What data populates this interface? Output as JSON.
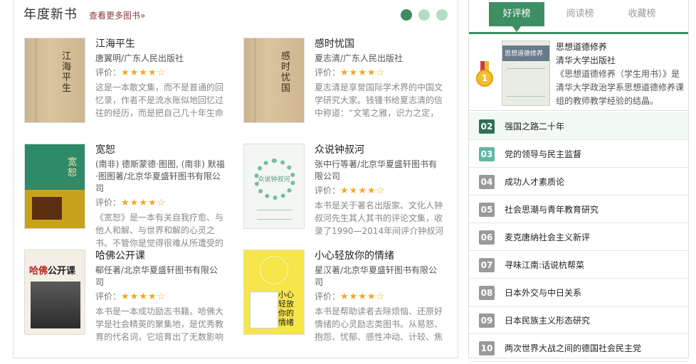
{
  "section": {
    "title": "年度新书",
    "more_link": "查看更多图书»"
  },
  "carousel": {
    "pages": 3,
    "active": 1
  },
  "books": [
    {
      "title": "江海平生",
      "author": "唐翼明/广东人民出版社",
      "rating_label": "评价：",
      "stars": "★★★★☆",
      "rating": 4,
      "desc": "这是一本散文集，而不是普通的回忆录，作者不是流水账似地回忆过往的经历，而是把自己几十年生命",
      "cover_text": "江海平生"
    },
    {
      "title": "感时忧国",
      "author": "夏志清/广东人民出版社",
      "rating_label": "评价：",
      "stars": "★★★★☆",
      "rating": 4,
      "desc": "夏志清是享誉国际学术界的中国文学研究大家。钱锺书给夏志清的信中称道：“文笔之雅，识力之定，",
      "cover_text": "感时忧国"
    },
    {
      "title": "宽恕",
      "author": "(南非) 德斯蒙德·图图, (南非) 默福·图图著/北京华夏盛轩图书有限公司",
      "rating_label": "评价：",
      "stars": "★★★★☆",
      "rating": 4,
      "desc": "《宽恕》是一本有关自我疗愈、与他人和解、与世界和解的心灵之书。不管你是觉得很难从所遭受的",
      "cover_text": "宽恕"
    },
    {
      "title": "众说钟叔河",
      "author": "张中行等著/北京华夏盛轩图书有限公司",
      "rating_label": "评价：",
      "stars": "★★★★☆",
      "rating": 4,
      "desc": "本书是关于著名出版家、文化人钟叔河先生其人其书的评论文集，收录了1990—2014年间评介钟叔河",
      "cover_text": "众说钟叔河"
    },
    {
      "title": "哈佛公开课",
      "author": "郗任著/北京华夏盛轩图书有限公司",
      "rating_label": "评价：",
      "stars": "★★★★☆",
      "rating": 4,
      "desc": "本书是一本成功励志书籍。哈佛大学是社会精英的聚集地，是优秀教育的代名词，它培育出了无数影响",
      "cover_text_a": "哈佛",
      "cover_text_b": "公开课"
    },
    {
      "title": "小心轻放你的情绪",
      "author": "星汉著/北京华夏盛轩图书有限公司",
      "rating_label": "评价：",
      "stars": "★★★★☆",
      "rating": 4,
      "desc": "本书是帮助读者去除烦恼、还原好情绪的心灵励志类图书。从易怒、抱怨、忧郁、感性冲动、计较、焦",
      "cover_text": "小心轻放你的情绪"
    }
  ],
  "tabs": [
    {
      "label": "好评榜",
      "active": true
    },
    {
      "label": "阅读榜",
      "active": false
    },
    {
      "label": "收藏榜",
      "active": false
    }
  ],
  "top_book": {
    "rank": "1",
    "title": "思想道德修养",
    "publisher": "清华大学出版社",
    "desc": "《思想道德修养（学生用书）》是清华大学政治学系思想道德修养课组的教师教学经验的结晶。",
    "cover_text": "思想道德修养"
  },
  "ranking": [
    {
      "num": "02",
      "title": "强国之路二十年"
    },
    {
      "num": "03",
      "title": "党的领导与民主监督"
    },
    {
      "num": "04",
      "title": "成功人才素质论"
    },
    {
      "num": "05",
      "title": "社会思潮与青年教育研究"
    },
    {
      "num": "06",
      "title": "麦克唐纳社会主义新评"
    },
    {
      "num": "07",
      "title": "寻味江南:话说杭帮菜"
    },
    {
      "num": "08",
      "title": "日本外交与中日关系"
    },
    {
      "num": "09",
      "title": "日本民族主义形态研究"
    },
    {
      "num": "10",
      "title": "两次世界大战之间的德国社会民主党"
    }
  ],
  "colors": {
    "accent": "#3e8e64",
    "star": "#f5a623",
    "more_link": "#8b3a3a"
  }
}
